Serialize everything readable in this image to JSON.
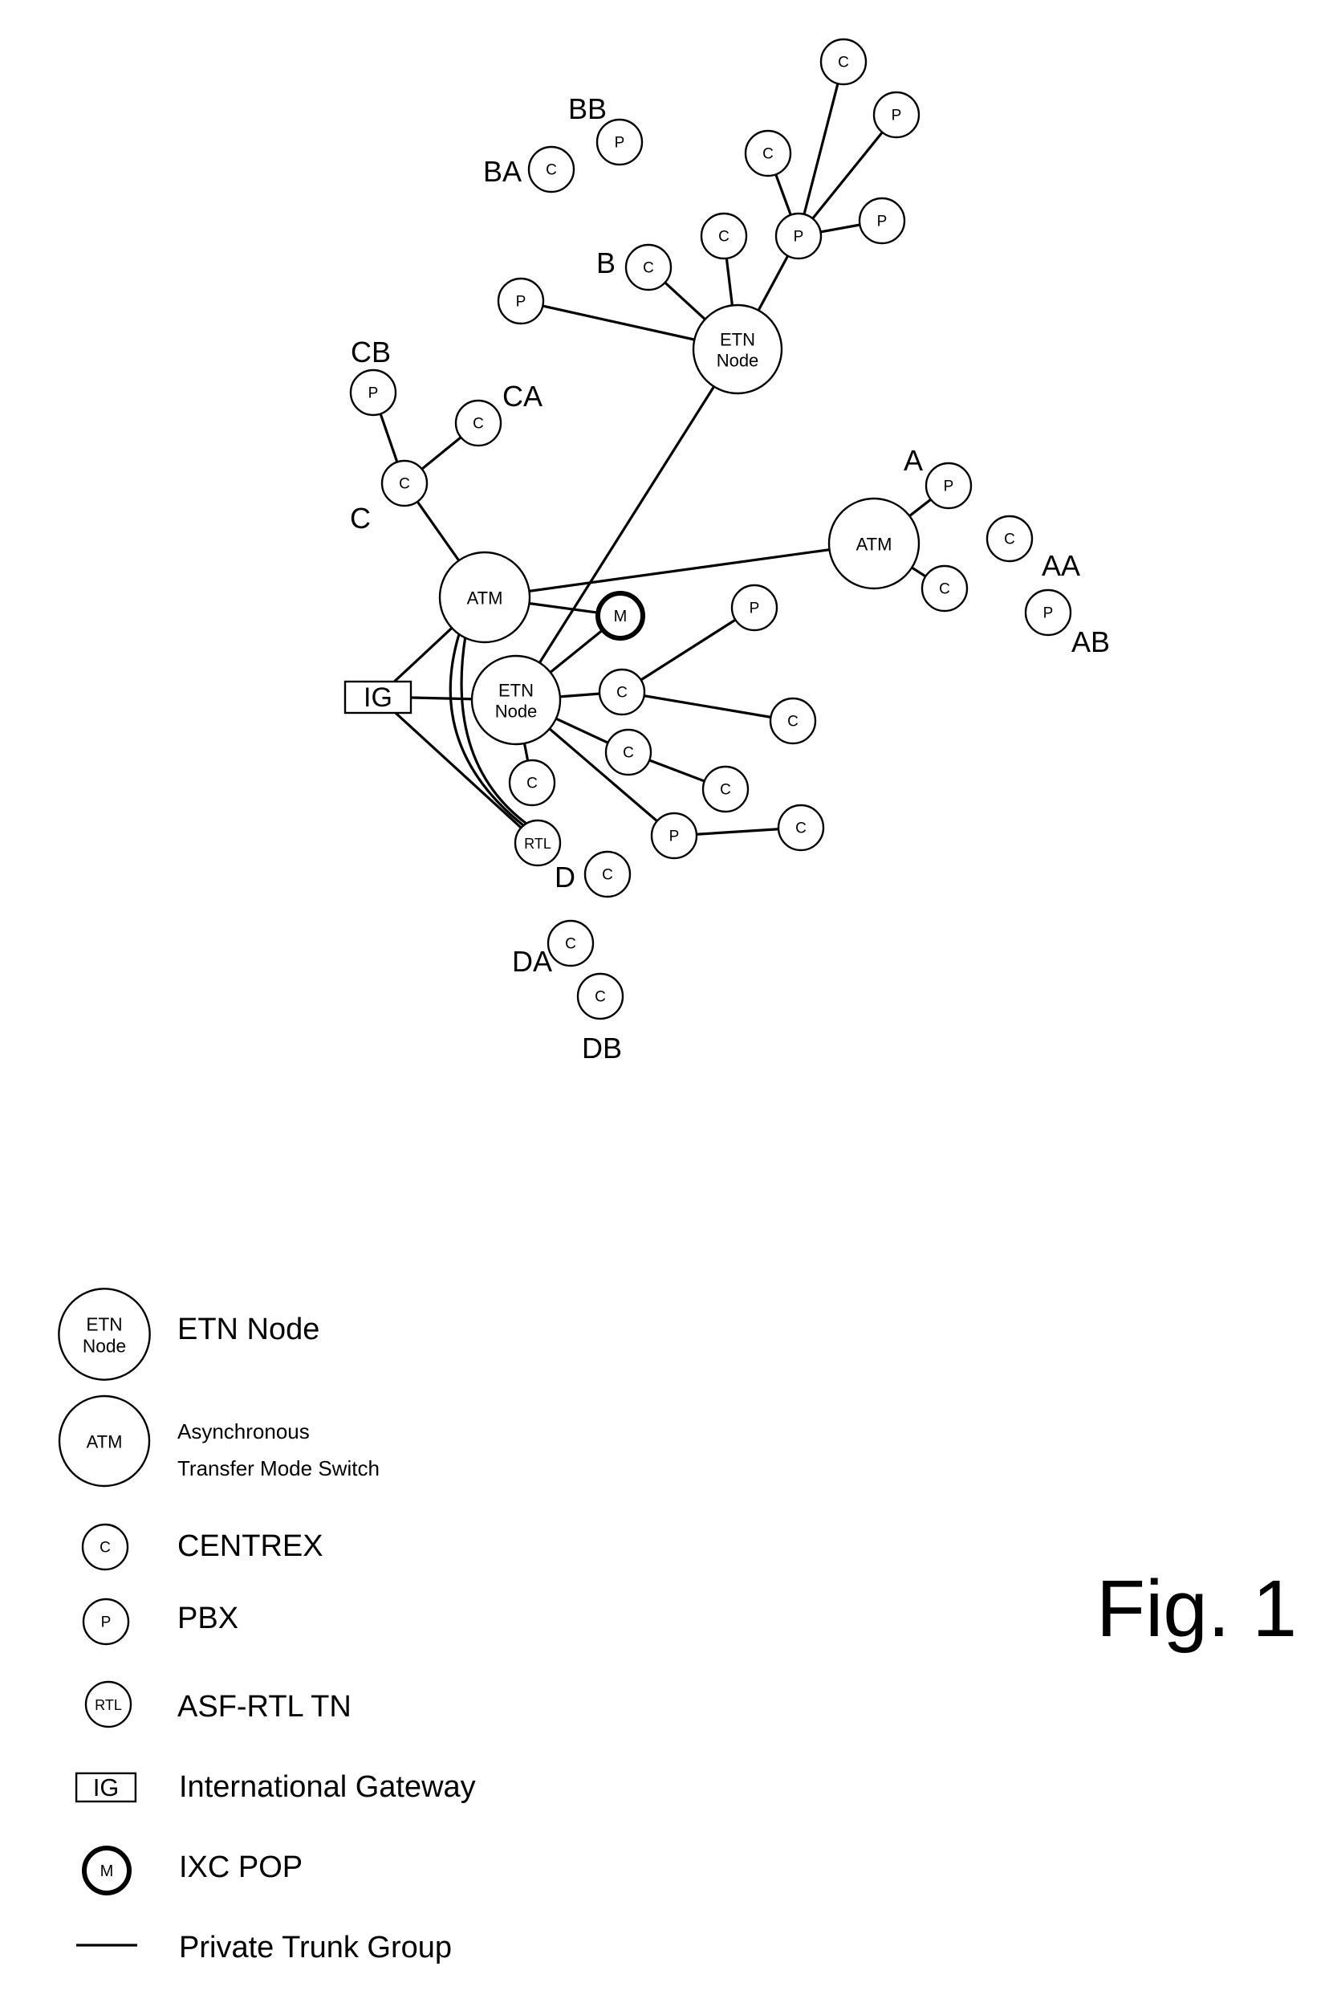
{
  "figure": {
    "title": "Fig. 1"
  },
  "node_types": {
    "etn": [
      "ETN",
      "Node"
    ],
    "atm": "ATM",
    "centrex": "C",
    "pbx": "P",
    "rtl": "RTL",
    "ig": "IG",
    "ixc": "M"
  },
  "diagram": {
    "group_labels": [
      "BB",
      "BA",
      "B",
      "CB",
      "CA",
      "C",
      "A",
      "AA",
      "AB",
      "D",
      "DA",
      "DB"
    ],
    "nodes": [
      {
        "id": "etn_upper",
        "type": "etn"
      },
      {
        "id": "etn_lower",
        "type": "etn"
      },
      {
        "id": "atm_left",
        "type": "atm"
      },
      {
        "id": "atm_right",
        "type": "atm"
      },
      {
        "id": "ixc",
        "type": "ixc"
      },
      {
        "id": "ig",
        "type": "ig"
      },
      {
        "id": "rtl",
        "type": "rtl"
      },
      {
        "id": "ba_c",
        "type": "centrex",
        "group": "BA"
      },
      {
        "id": "bb_p",
        "type": "pbx",
        "group": "BB"
      },
      {
        "id": "b_c",
        "type": "centrex",
        "group": "B"
      },
      {
        "id": "p_left_upper",
        "type": "pbx"
      },
      {
        "id": "c_mid_upper",
        "type": "centrex"
      },
      {
        "id": "p_hub",
        "type": "pbx"
      },
      {
        "id": "c_top",
        "type": "centrex"
      },
      {
        "id": "p_top_right",
        "type": "pbx"
      },
      {
        "id": "c_upper_hub",
        "type": "centrex"
      },
      {
        "id": "p_right_hub",
        "type": "pbx"
      },
      {
        "id": "cb_p",
        "type": "pbx",
        "group": "CB"
      },
      {
        "id": "ca_c",
        "type": "centrex",
        "group": "CA"
      },
      {
        "id": "c_c",
        "type": "centrex",
        "group": "C"
      },
      {
        "id": "a_p",
        "type": "pbx",
        "group": "A"
      },
      {
        "id": "a_c",
        "type": "centrex"
      },
      {
        "id": "aa_c",
        "type": "centrex",
        "group": "AA"
      },
      {
        "id": "ab_p",
        "type": "pbx",
        "group": "AB"
      },
      {
        "id": "c_near_etn",
        "type": "centrex"
      },
      {
        "id": "p_far",
        "type": "pbx"
      },
      {
        "id": "c_far_right",
        "type": "centrex"
      },
      {
        "id": "c_lower1",
        "type": "centrex"
      },
      {
        "id": "c_lower2",
        "type": "centrex"
      },
      {
        "id": "c_below_etn",
        "type": "centrex"
      },
      {
        "id": "p_lower",
        "type": "pbx"
      },
      {
        "id": "c_lower_right",
        "type": "centrex"
      },
      {
        "id": "d_c",
        "type": "centrex",
        "group": "D"
      },
      {
        "id": "da_c",
        "type": "centrex",
        "group": "DA"
      },
      {
        "id": "db_c",
        "type": "centrex",
        "group": "DB"
      }
    ],
    "edges": [
      [
        "etn_upper",
        "p_left_upper"
      ],
      [
        "etn_upper",
        "b_c"
      ],
      [
        "etn_upper",
        "c_mid_upper"
      ],
      [
        "etn_upper",
        "p_hub"
      ],
      [
        "p_hub",
        "c_top"
      ],
      [
        "p_hub",
        "p_top_right"
      ],
      [
        "p_hub",
        "c_upper_hub"
      ],
      [
        "p_hub",
        "p_right_hub"
      ],
      [
        "etn_upper",
        "etn_lower"
      ],
      [
        "c_c",
        "cb_p"
      ],
      [
        "c_c",
        "ca_c"
      ],
      [
        "c_c",
        "atm_left"
      ],
      [
        "atm_left",
        "atm_right"
      ],
      [
        "atm_right",
        "a_p"
      ],
      [
        "atm_right",
        "a_c"
      ],
      [
        "atm_left",
        "ixc"
      ],
      [
        "etn_lower",
        "ixc"
      ],
      [
        "ig",
        "atm_left"
      ],
      [
        "ig",
        "etn_lower"
      ],
      [
        "ig",
        "rtl"
      ],
      [
        "atm_left",
        "rtl",
        "curved"
      ],
      [
        "atm_left",
        "rtl",
        "curved"
      ],
      [
        "etn_lower",
        "c_near_etn"
      ],
      [
        "c_near_etn",
        "p_far"
      ],
      [
        "c_near_etn",
        "c_far_right"
      ],
      [
        "etn_lower",
        "c_lower1"
      ],
      [
        "c_lower1",
        "c_lower2"
      ],
      [
        "etn_lower",
        "c_below_etn"
      ],
      [
        "etn_lower",
        "p_lower"
      ],
      [
        "p_lower",
        "c_lower_right"
      ]
    ]
  },
  "legend": {
    "items": [
      {
        "symbol": "etn",
        "label": "ETN Node"
      },
      {
        "symbol": "atm",
        "label_lines": [
          "Asynchronous",
          "Transfer Mode Switch"
        ]
      },
      {
        "symbol": "centrex",
        "label": "CENTREX"
      },
      {
        "symbol": "pbx",
        "label": "PBX"
      },
      {
        "symbol": "rtl",
        "label": "ASF-RTL TN"
      },
      {
        "symbol": "ig",
        "label": "International Gateway"
      },
      {
        "symbol": "ixc",
        "label": "IXC POP"
      },
      {
        "symbol": "trunk",
        "label": "Private Trunk Group"
      }
    ]
  }
}
